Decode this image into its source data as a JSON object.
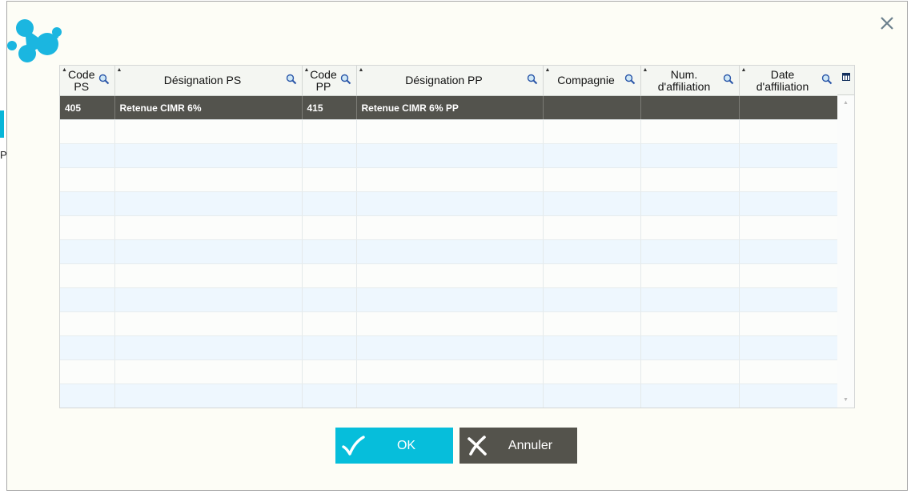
{
  "dialog": {
    "close_icon": "close-icon",
    "logo_icon": "bubbles-logo"
  },
  "grid": {
    "columns": [
      {
        "line1": "Code",
        "line2": "PS"
      },
      {
        "line1": "Désignation PS",
        "line2": ""
      },
      {
        "line1": "Code",
        "line2": "PP"
      },
      {
        "line1": "Désignation PP",
        "line2": ""
      },
      {
        "line1": "Compagnie",
        "line2": ""
      },
      {
        "line1": "Num.",
        "line2": "d'affiliation"
      },
      {
        "line1": "Date",
        "line2": "d'affiliation"
      }
    ],
    "rows": [
      [
        "405",
        "Retenue CIMR 6%",
        "415",
        "Retenue CIMR 6% PP",
        "",
        "",
        ""
      ]
    ],
    "selected_row": 0,
    "header_sort_icon": "sort-arrows-icon",
    "header_search_icon": "search-icon",
    "corner_icon": "column-chooser-icon"
  },
  "buttons": {
    "ok_label": "OK",
    "cancel_label": "Annuler"
  },
  "colors": {
    "accent": "#06bedb",
    "dark": "#54534c",
    "selected_row": "#53534d"
  },
  "background": {
    "partial_char": "P"
  }
}
